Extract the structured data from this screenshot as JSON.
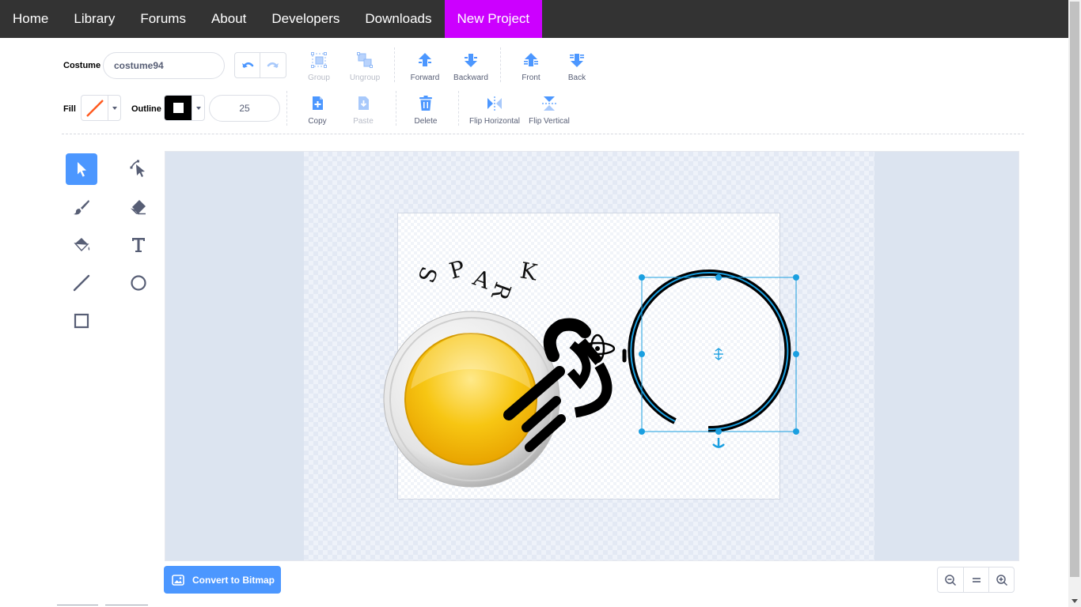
{
  "nav": {
    "items": [
      {
        "label": "Home"
      },
      {
        "label": "Library"
      },
      {
        "label": "Forums"
      },
      {
        "label": "About"
      },
      {
        "label": "Developers"
      },
      {
        "label": "Downloads"
      },
      {
        "label": "New Project",
        "active": true
      }
    ],
    "active_color": "#cc00ff",
    "bg_color": "#333333"
  },
  "toolbar": {
    "costume_label": "Costume",
    "costume_name": "costume94",
    "undo_icon": "undo-icon",
    "redo_icon": "redo-icon",
    "group_label": "Group",
    "ungroup_label": "Ungroup",
    "forward_label": "Forward",
    "backward_label": "Backward",
    "front_label": "Front",
    "back_label": "Back",
    "fill_label": "Fill",
    "outline_label": "Outline",
    "outline_width": "25",
    "copy_label": "Copy",
    "paste_label": "Paste",
    "delete_label": "Delete",
    "flip_horizontal_label": "Flip Horizontal",
    "flip_vertical_label": "Flip Vertical",
    "fill_color": "none",
    "outline_color": "#000000"
  },
  "tools": {
    "items": [
      {
        "name": "select",
        "icon": "select-arrow-icon",
        "active": true
      },
      {
        "name": "reshape",
        "icon": "reshape-icon"
      },
      {
        "name": "brush",
        "icon": "brush-icon"
      },
      {
        "name": "eraser",
        "icon": "eraser-icon"
      },
      {
        "name": "fill",
        "icon": "paint-bucket-icon"
      },
      {
        "name": "text",
        "icon": "text-icon"
      },
      {
        "name": "line",
        "icon": "line-icon"
      },
      {
        "name": "circle",
        "icon": "circle-icon"
      },
      {
        "name": "rectangle",
        "icon": "rectangle-icon"
      }
    ],
    "accent": "#4c97ff"
  },
  "canvas": {
    "artwork_text": "SPARK"
  },
  "footer": {
    "convert_label": "Convert to Bitmap",
    "zoom_out_icon": "zoom-out-icon",
    "zoom_reset_icon": "zoom-reset-icon",
    "zoom_in_icon": "zoom-in-icon"
  }
}
